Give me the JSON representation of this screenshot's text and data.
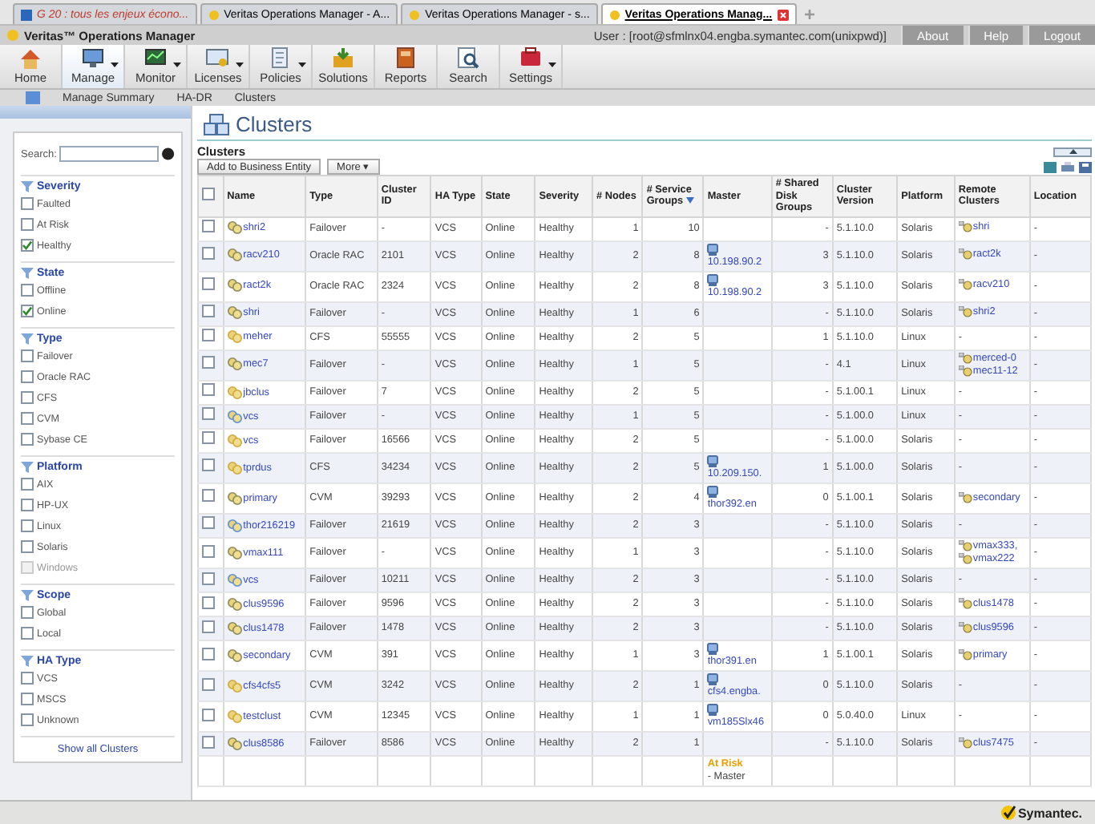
{
  "browser_tabs": [
    {
      "title": "G 20 : tous les enjeux écono...",
      "selected": false,
      "kind": "news"
    },
    {
      "title": "Veritas Operations Manager - A...",
      "selected": false,
      "kind": "app"
    },
    {
      "title": "Veritas Operations Manager - s...",
      "selected": false,
      "kind": "app"
    },
    {
      "title": "Veritas Operations Manag...",
      "selected": true,
      "kind": "app"
    }
  ],
  "app_title": "Veritas™ Operations Manager",
  "user": "User : [root@sfmlnx04.engba.symantec.com(unixpwd)]",
  "header_links": [
    "About",
    "Help",
    "Logout"
  ],
  "toolbar": [
    {
      "label": "Home",
      "kind": "home",
      "selected": false,
      "has_menu": false
    },
    {
      "label": "Manage",
      "kind": "manage",
      "selected": true,
      "has_menu": true
    },
    {
      "label": "Monitor",
      "kind": "monitor",
      "selected": false,
      "has_menu": true
    },
    {
      "label": "Licenses",
      "kind": "licenses",
      "selected": false,
      "has_menu": true
    },
    {
      "label": "Policies",
      "kind": "policies",
      "selected": false,
      "has_menu": true
    },
    {
      "label": "Solutions",
      "kind": "solutions",
      "selected": false,
      "has_menu": false
    },
    {
      "label": "Reports",
      "kind": "reports",
      "selected": false,
      "has_menu": false
    },
    {
      "label": "Search",
      "kind": "search",
      "selected": false,
      "has_menu": false
    },
    {
      "label": "Settings",
      "kind": "settings",
      "selected": false,
      "has_menu": true
    }
  ],
  "breadcrumb": [
    "Manage Summary",
    "HA-DR",
    "Clusters"
  ],
  "sidebar": {
    "search_label": "Search:",
    "groups": [
      {
        "title": "Severity",
        "items": [
          {
            "label": "Faulted",
            "checked": false,
            "disabled": false
          },
          {
            "label": "At Risk",
            "checked": false,
            "disabled": false
          },
          {
            "label": "Healthy",
            "checked": true,
            "disabled": false
          }
        ]
      },
      {
        "title": "State",
        "items": [
          {
            "label": "Offline",
            "checked": false,
            "disabled": false
          },
          {
            "label": "Online",
            "checked": true,
            "disabled": false
          }
        ]
      },
      {
        "title": "Type",
        "items": [
          {
            "label": "Failover",
            "checked": false,
            "disabled": false
          },
          {
            "label": "Oracle RAC",
            "checked": false,
            "disabled": false
          },
          {
            "label": "CFS",
            "checked": false,
            "disabled": false
          },
          {
            "label": "CVM",
            "checked": false,
            "disabled": false
          },
          {
            "label": "Sybase CE",
            "checked": false,
            "disabled": false
          }
        ]
      },
      {
        "title": "Platform",
        "items": [
          {
            "label": "AIX",
            "checked": false,
            "disabled": false
          },
          {
            "label": "HP-UX",
            "checked": false,
            "disabled": false
          },
          {
            "label": "Linux",
            "checked": false,
            "disabled": false
          },
          {
            "label": "Solaris",
            "checked": false,
            "disabled": false
          },
          {
            "label": "Windows",
            "checked": false,
            "disabled": true
          }
        ]
      },
      {
        "title": "Scope",
        "items": [
          {
            "label": "Global",
            "checked": false,
            "disabled": false
          },
          {
            "label": "Local",
            "checked": false,
            "disabled": false
          }
        ]
      },
      {
        "title": "HA Type",
        "items": [
          {
            "label": "VCS",
            "checked": false,
            "disabled": false
          },
          {
            "label": "MSCS",
            "checked": false,
            "disabled": false
          },
          {
            "label": "Unknown",
            "checked": false,
            "disabled": false
          }
        ]
      }
    ],
    "show_all": "Show all Clusters"
  },
  "page_title": "Clusters",
  "section_title": "Clusters",
  "actions": [
    "Add to Business Entity",
    "More ▾"
  ],
  "table": {
    "header_checked": false,
    "columns": [
      {
        "label": "Name",
        "sorted": false
      },
      {
        "label": "Type",
        "sorted": false
      },
      {
        "label": "Cluster ID",
        "sorted": false
      },
      {
        "label": "HA Type",
        "sorted": false
      },
      {
        "label": "State",
        "sorted": false
      },
      {
        "label": "Severity",
        "sorted": false
      },
      {
        "label": "# Nodes",
        "sorted": false
      },
      {
        "label": "# Service Groups",
        "sorted": true
      },
      {
        "label": "Master",
        "sorted": false
      },
      {
        "label": "# Shared Disk Groups",
        "sorted": false
      },
      {
        "label": "Cluster Version",
        "sorted": false
      },
      {
        "label": "Platform",
        "sorted": false
      },
      {
        "label": "Remote Clusters",
        "sorted": false
      },
      {
        "label": "Location",
        "sorted": false
      }
    ],
    "rows": [
      {
        "checked": false,
        "name": "shri2",
        "kind": "failover",
        "type": "Failover",
        "cluster_id": "-",
        "ha_type": "VCS",
        "state": "Online",
        "severity": "Healthy",
        "nodes": "1",
        "service_groups": "10",
        "shared_disk_groups": "-",
        "version": "5.1.10.0",
        "platform": "Solaris",
        "remote": [
          "shri"
        ],
        "location": "-"
      },
      {
        "checked": false,
        "name": "racv210",
        "kind": "failover",
        "type": "Oracle RAC",
        "cluster_id": "2101",
        "ha_type": "VCS",
        "state": "Online",
        "severity": "Healthy",
        "nodes": "2",
        "service_groups": "8",
        "master": "10.198.90.2",
        "shared_disk_groups": "3",
        "version": "5.1.10.0",
        "platform": "Solaris",
        "remote": [
          "ract2k"
        ],
        "location": "-"
      },
      {
        "checked": false,
        "name": "ract2k",
        "kind": "failover",
        "type": "Oracle RAC",
        "cluster_id": "2324",
        "ha_type": "VCS",
        "state": "Online",
        "severity": "Healthy",
        "nodes": "2",
        "service_groups": "8",
        "master": "10.198.90.2",
        "shared_disk_groups": "3",
        "version": "5.1.10.0",
        "platform": "Solaris",
        "remote": [
          "racv210"
        ],
        "location": "-"
      },
      {
        "checked": false,
        "name": "shri",
        "kind": "failover",
        "type": "Failover",
        "cluster_id": "-",
        "ha_type": "VCS",
        "state": "Online",
        "severity": "Healthy",
        "nodes": "1",
        "service_groups": "6",
        "shared_disk_groups": "-",
        "version": "5.1.10.0",
        "platform": "Solaris",
        "remote": [
          "shri2"
        ],
        "location": "-"
      },
      {
        "checked": false,
        "name": "meher",
        "kind": "shared",
        "type": "CFS",
        "cluster_id": "55555",
        "ha_type": "VCS",
        "state": "Online",
        "severity": "Healthy",
        "nodes": "2",
        "service_groups": "5",
        "shared_disk_groups": "1",
        "version": "5.1.10.0",
        "platform": "Linux",
        "remote_text": "-",
        "location": "-"
      },
      {
        "checked": false,
        "name": "mec7",
        "kind": "failover",
        "type": "Failover",
        "cluster_id": "-",
        "ha_type": "VCS",
        "state": "Online",
        "severity": "Healthy",
        "nodes": "1",
        "service_groups": "5",
        "shared_disk_groups": "-",
        "version": "4.1",
        "platform": "Linux",
        "remote": [
          "merced-0",
          "mec11-12"
        ],
        "location": "-"
      },
      {
        "checked": false,
        "name": "jbclus",
        "kind": "shared",
        "type": "Failover",
        "cluster_id": "7",
        "ha_type": "VCS",
        "state": "Online",
        "severity": "Healthy",
        "nodes": "2",
        "service_groups": "5",
        "shared_disk_groups": "-",
        "version": "5.1.00.1",
        "platform": "Linux",
        "remote_text": "-",
        "location": "-"
      },
      {
        "checked": false,
        "name": "vcs",
        "kind": "windows",
        "type": "Failover",
        "cluster_id": "-",
        "ha_type": "VCS",
        "state": "Online",
        "severity": "Healthy",
        "nodes": "1",
        "service_groups": "5",
        "shared_disk_groups": "-",
        "version": "5.1.00.0",
        "platform": "Linux",
        "remote_text": "-",
        "location": "-"
      },
      {
        "checked": false,
        "name": "vcs",
        "kind": "shared",
        "type": "Failover",
        "cluster_id": "16566",
        "ha_type": "VCS",
        "state": "Online",
        "severity": "Healthy",
        "nodes": "2",
        "service_groups": "5",
        "shared_disk_groups": "-",
        "version": "5.1.00.0",
        "platform": "Solaris",
        "remote_text": "-",
        "location": "-"
      },
      {
        "checked": false,
        "name": "tprdus",
        "kind": "shared",
        "type": "CFS",
        "cluster_id": "34234",
        "ha_type": "VCS",
        "state": "Online",
        "severity": "Healthy",
        "nodes": "2",
        "service_groups": "5",
        "master": "10.209.150.",
        "shared_disk_groups": "1",
        "version": "5.1.00.0",
        "platform": "Solaris",
        "remote_text": "-",
        "location": "-"
      },
      {
        "checked": false,
        "name": "primary",
        "kind": "failover",
        "type": "CVM",
        "cluster_id": "39293",
        "ha_type": "VCS",
        "state": "Online",
        "severity": "Healthy",
        "nodes": "2",
        "service_groups": "4",
        "master": "thor392.en",
        "shared_disk_groups": "0",
        "version": "5.1.00.1",
        "platform": "Solaris",
        "remote": [
          "secondary"
        ],
        "location": "-"
      },
      {
        "checked": false,
        "name": "thor216219",
        "kind": "windows",
        "type": "Failover",
        "cluster_id": "21619",
        "ha_type": "VCS",
        "state": "Online",
        "severity": "Healthy",
        "nodes": "2",
        "service_groups": "3",
        "shared_disk_groups": "-",
        "version": "5.1.10.0",
        "platform": "Solaris",
        "remote_text": "-",
        "location": "-"
      },
      {
        "checked": false,
        "name": "vmax111",
        "kind": "failover",
        "type": "Failover",
        "cluster_id": "-",
        "ha_type": "VCS",
        "state": "Online",
        "severity": "Healthy",
        "nodes": "1",
        "service_groups": "3",
        "shared_disk_groups": "-",
        "version": "5.1.10.0",
        "platform": "Solaris",
        "remote": [
          "vmax333,",
          "vmax222"
        ],
        "location": "-"
      },
      {
        "checked": false,
        "name": "vcs",
        "kind": "windows",
        "type": "Failover",
        "cluster_id": "10211",
        "ha_type": "VCS",
        "state": "Online",
        "severity": "Healthy",
        "nodes": "2",
        "service_groups": "3",
        "shared_disk_groups": "-",
        "version": "5.1.10.0",
        "platform": "Solaris",
        "remote_text": "-",
        "location": "-"
      },
      {
        "checked": false,
        "name": "clus9596",
        "kind": "failover",
        "type": "Failover",
        "cluster_id": "9596",
        "ha_type": "VCS",
        "state": "Online",
        "severity": "Healthy",
        "nodes": "2",
        "service_groups": "3",
        "shared_disk_groups": "-",
        "version": "5.1.10.0",
        "platform": "Solaris",
        "remote": [
          "clus1478"
        ],
        "location": "-"
      },
      {
        "checked": false,
        "name": "clus1478",
        "kind": "failover",
        "type": "Failover",
        "cluster_id": "1478",
        "ha_type": "VCS",
        "state": "Online",
        "severity": "Healthy",
        "nodes": "2",
        "service_groups": "3",
        "shared_disk_groups": "-",
        "version": "5.1.10.0",
        "platform": "Solaris",
        "remote": [
          "clus9596"
        ],
        "location": "-"
      },
      {
        "checked": false,
        "name": "secondary",
        "kind": "failover",
        "type": "CVM",
        "cluster_id": "391",
        "ha_type": "VCS",
        "state": "Online",
        "severity": "Healthy",
        "nodes": "1",
        "service_groups": "3",
        "master": "thor391.en",
        "shared_disk_groups": "1",
        "version": "5.1.00.1",
        "platform": "Solaris",
        "remote": [
          "primary"
        ],
        "location": "-"
      },
      {
        "checked": false,
        "name": "cfs4cfs5",
        "kind": "shared",
        "type": "CVM",
        "cluster_id": "3242",
        "ha_type": "VCS",
        "state": "Online",
        "severity": "Healthy",
        "nodes": "2",
        "service_groups": "1",
        "master": "cfs4.engba.",
        "shared_disk_groups": "0",
        "version": "5.1.10.0",
        "platform": "Solaris",
        "remote_text": "-",
        "location": "-"
      },
      {
        "checked": false,
        "name": "testclust",
        "kind": "shared",
        "type": "CVM",
        "cluster_id": "12345",
        "ha_type": "VCS",
        "state": "Online",
        "severity": "Healthy",
        "nodes": "1",
        "service_groups": "1",
        "master": "vm185Slx46",
        "shared_disk_groups": "0",
        "version": "5.0.40.0",
        "platform": "Linux",
        "remote_text": "-",
        "location": "-"
      },
      {
        "checked": false,
        "name": "clus8586",
        "kind": "failover",
        "type": "Failover",
        "cluster_id": "8586",
        "ha_type": "VCS",
        "state": "Online",
        "severity": "Healthy",
        "nodes": "2",
        "service_groups": "1",
        "shared_disk_groups": "-",
        "version": "5.1.10.0",
        "platform": "Solaris",
        "remote": [
          "clus7475"
        ],
        "location": "-"
      }
    ],
    "partial_row": {
      "status": "At Risk",
      "note": "- Master"
    }
  },
  "footer_brand": "Symantec."
}
